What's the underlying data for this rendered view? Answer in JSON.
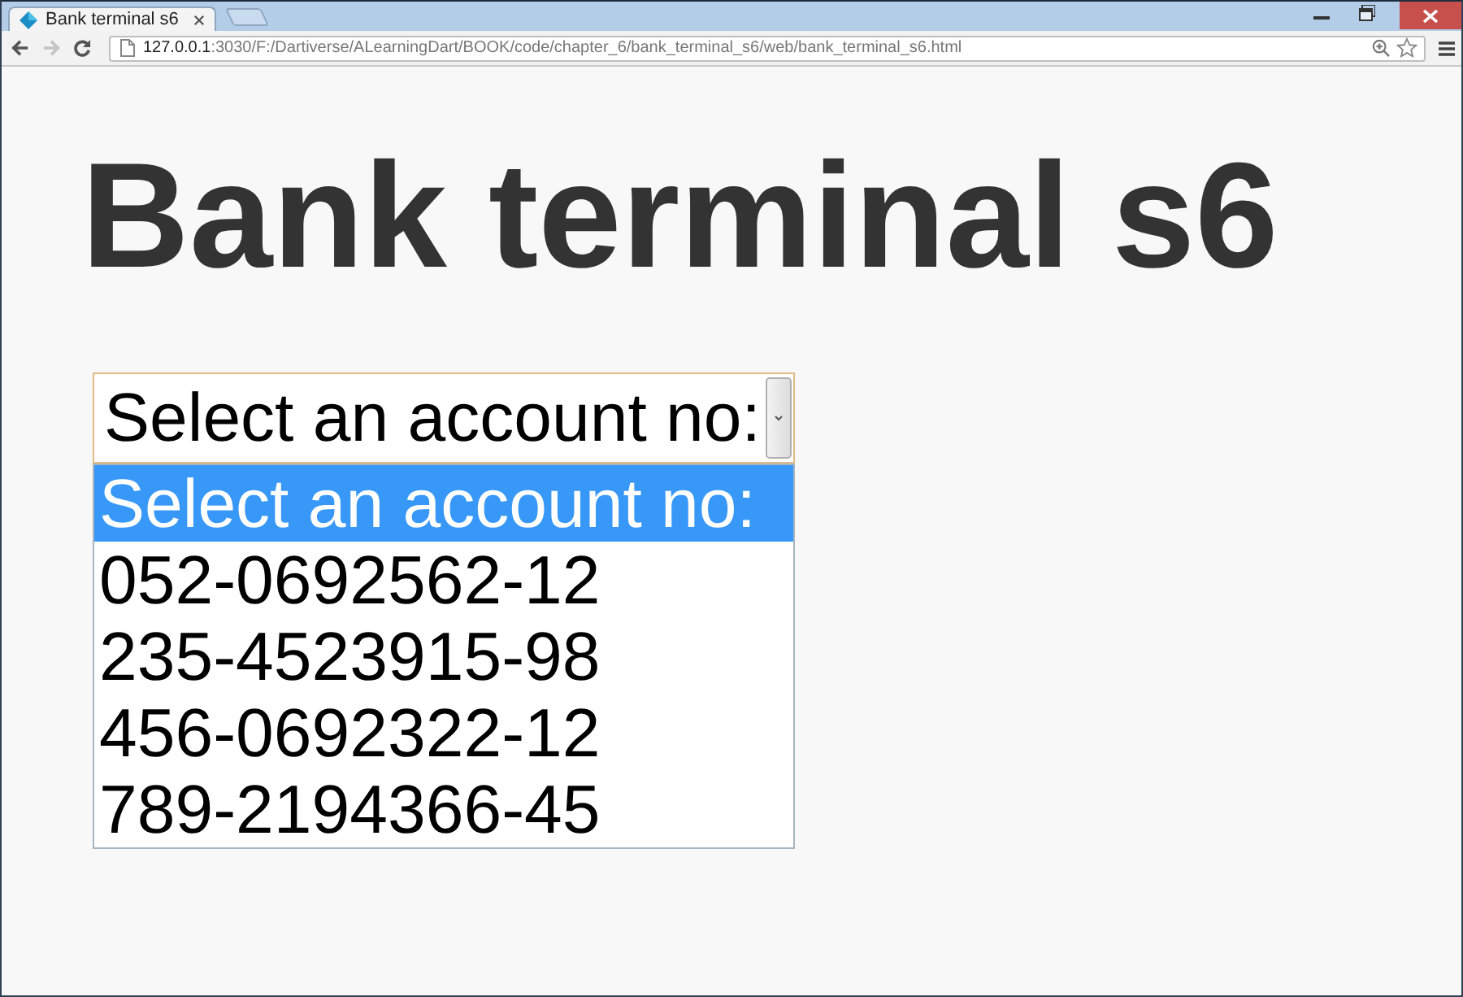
{
  "browser": {
    "tab": {
      "title": "Bank terminal s6"
    },
    "toolbar": {
      "back_disabled": false,
      "forward_disabled": true
    },
    "address": {
      "host": "127.0.0.1",
      "path": ":3030/F:/Dartiverse/ALearningDart/BOOK/code/chapter_6/bank_terminal_s6/web/bank_terminal_s6.html"
    }
  },
  "page": {
    "heading": "Bank terminal s6",
    "account_select": {
      "value": "Select an account no:",
      "expanded": true,
      "options": [
        {
          "label": "Select an account no:",
          "selected": true
        },
        {
          "label": "052-0692562-12",
          "selected": false
        },
        {
          "label": "235-4523915-98",
          "selected": false
        },
        {
          "label": "456-0692322-12",
          "selected": false
        },
        {
          "label": "789-2194366-45",
          "selected": false
        }
      ]
    }
  }
}
